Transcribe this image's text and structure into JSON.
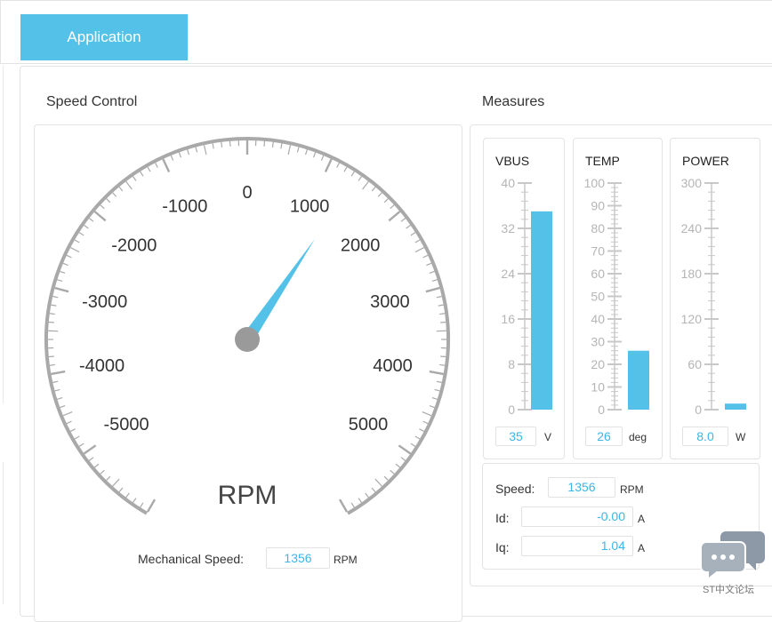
{
  "tabs": [
    {
      "label": "Application",
      "active": true
    }
  ],
  "colors": {
    "accent": "#54c1e9",
    "value_text": "#3bb6e6",
    "gauge_rim": "#a9a9a9",
    "needle_hub": "#9a9a9a"
  },
  "speed_control": {
    "title": "Speed Control",
    "gauge": {
      "unit_label": "RPM",
      "min": -6000,
      "max": 6000,
      "tick_labels": [
        "-5000",
        "-4000",
        "-3000",
        "-2000",
        "-1000",
        "0",
        "1000",
        "2000",
        "3000",
        "4000",
        "5000"
      ],
      "value": 1356
    },
    "mechanical_speed": {
      "label": "Mechanical Speed:",
      "value": "1356",
      "unit": "RPM"
    }
  },
  "measures": {
    "title": "Measures",
    "meters": [
      {
        "id": "vbus",
        "title": "VBUS",
        "scale_max": 40,
        "labels": [
          "40",
          "32",
          "24",
          "16",
          "8",
          "0"
        ],
        "value": 35,
        "display": "35",
        "unit": "V"
      },
      {
        "id": "temp",
        "title": "TEMP",
        "scale_max": 100,
        "labels": [
          "100",
          "90",
          "80",
          "70",
          "60",
          "50",
          "40",
          "30",
          "20",
          "10",
          "0"
        ],
        "value": 26,
        "display": "26",
        "unit": "deg"
      },
      {
        "id": "power",
        "title": "POWER",
        "scale_max": 300,
        "labels": [
          "300",
          "240",
          "180",
          "120",
          "60",
          "0"
        ],
        "value": 8,
        "display": "8.0",
        "unit": "W"
      }
    ],
    "speed": {
      "label": "Speed:",
      "value": "1356",
      "unit": "RPM"
    },
    "id": {
      "label": "Id:",
      "value": "-0.00",
      "unit": "A"
    },
    "iq": {
      "label": "Iq:",
      "value": "1.04",
      "unit": "A"
    }
  },
  "watermark": {
    "text": "ST中文论坛",
    "icon": "chat-bubbles-icon"
  }
}
